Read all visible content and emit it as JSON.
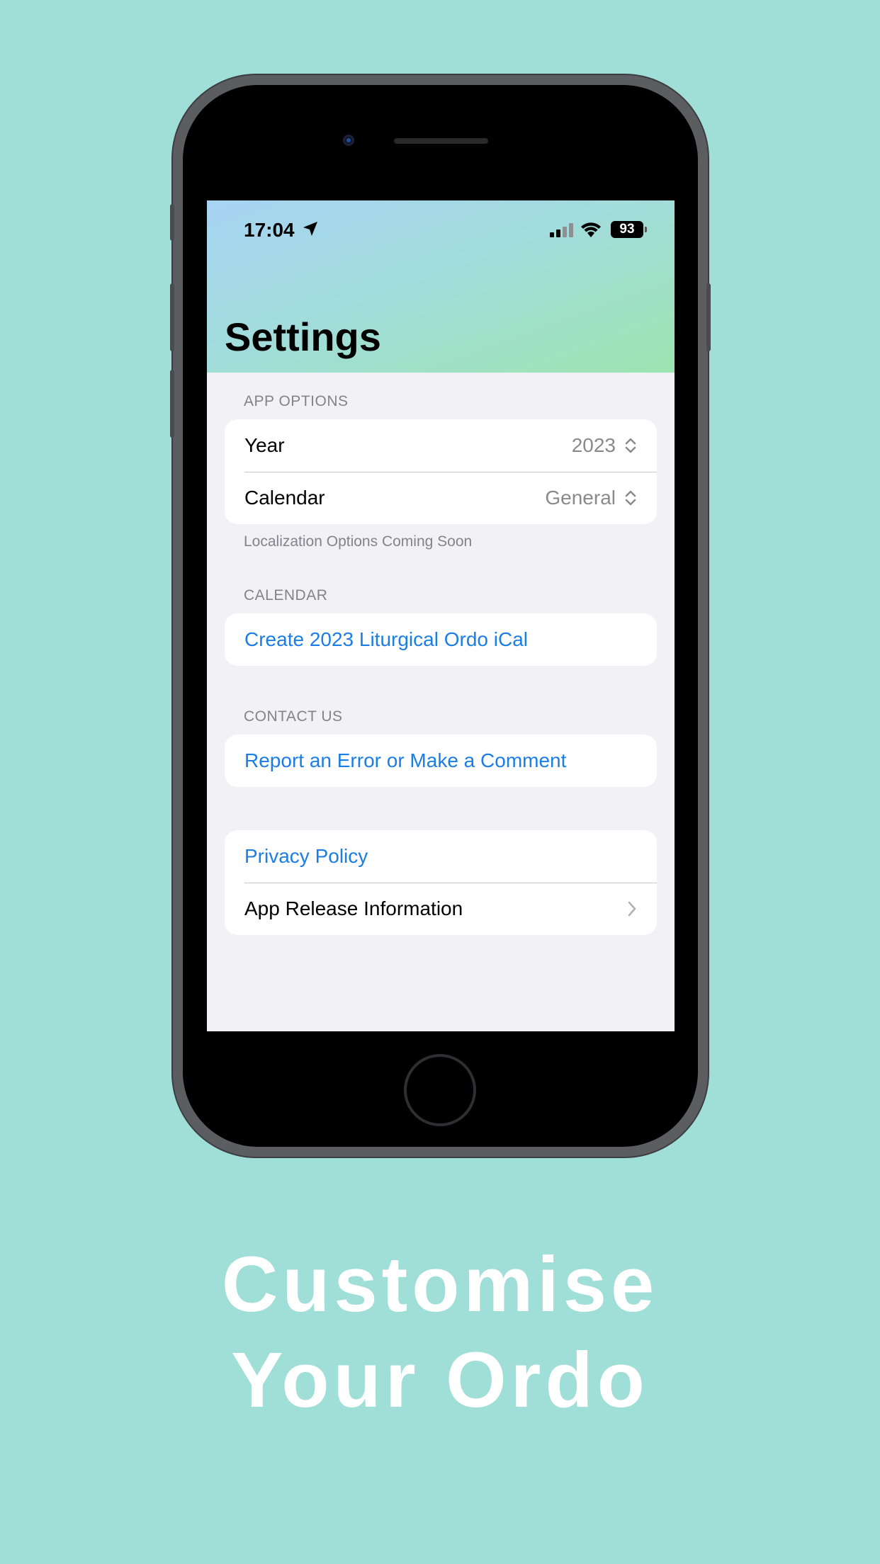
{
  "status_bar": {
    "time": "17:04",
    "battery": "93"
  },
  "nav": {
    "title": "Settings"
  },
  "sections": {
    "app_options": {
      "header": "APP OPTIONS",
      "year_label": "Year",
      "year_value": "2023",
      "calendar_label": "Calendar",
      "calendar_value": "General",
      "footer": "Localization Options Coming Soon"
    },
    "calendar": {
      "header": "CALENDAR",
      "create_ical": "Create 2023 Liturgical Ordo iCal"
    },
    "contact": {
      "header": "CONTACT US",
      "report": "Report an Error or Make a Comment"
    },
    "info": {
      "privacy": "Privacy Policy",
      "release": "App Release Information"
    }
  },
  "tagline": {
    "line1": "Customise",
    "line2": "Your Ordo"
  },
  "colors": {
    "background": "#a0ded8",
    "link": "#1a7ee6",
    "grouped_bg": "#f1f1f6"
  }
}
